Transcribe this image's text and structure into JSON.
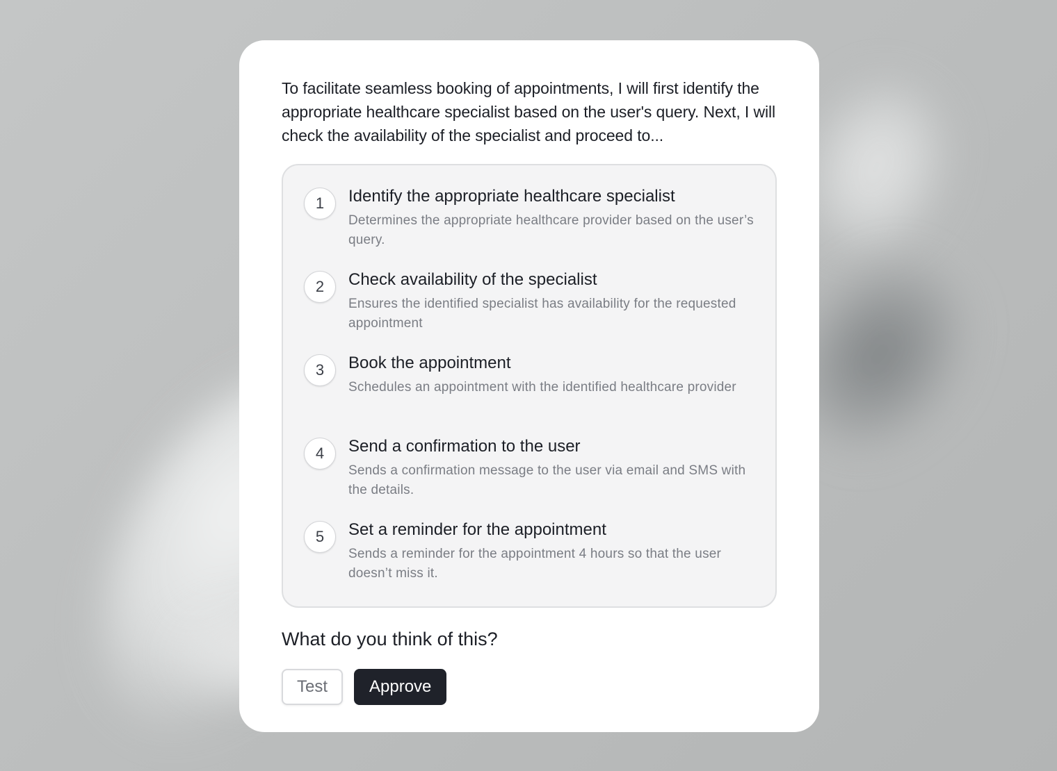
{
  "intro_text": "To facilitate seamless booking of appointments, I will first identify the appropriate healthcare specialist based on the user's query. Next, I will check the availability of the specialist and proceed to...",
  "steps": [
    {
      "number": "1",
      "title": "Identify the appropriate healthcare specialist",
      "description": "Determines the appropriate healthcare provider based on the user’s query."
    },
    {
      "number": "2",
      "title": "Check availability of the specialist",
      "description": "Ensures the identified specialist has availability for the requested appointment"
    },
    {
      "number": "3",
      "title": "Book the appointment",
      "description": "Schedules an appointment with the identified healthcare provider"
    },
    {
      "number": "4",
      "title": "Send a confirmation to the user",
      "description": "Sends a confirmation message to the user via email and SMS with the details."
    },
    {
      "number": "5",
      "title": "Set a reminder for the appointment",
      "description": "Sends a reminder for the appointment 4 hours so that the user doesn’t miss it."
    }
  ],
  "question": "What do you think of this?",
  "buttons": {
    "test_label": "Test",
    "approve_label": "Approve"
  },
  "colors": {
    "primary_button": "#1f222a",
    "card_background": "#ffffff",
    "steps_panel_background": "#f4f4f5"
  }
}
